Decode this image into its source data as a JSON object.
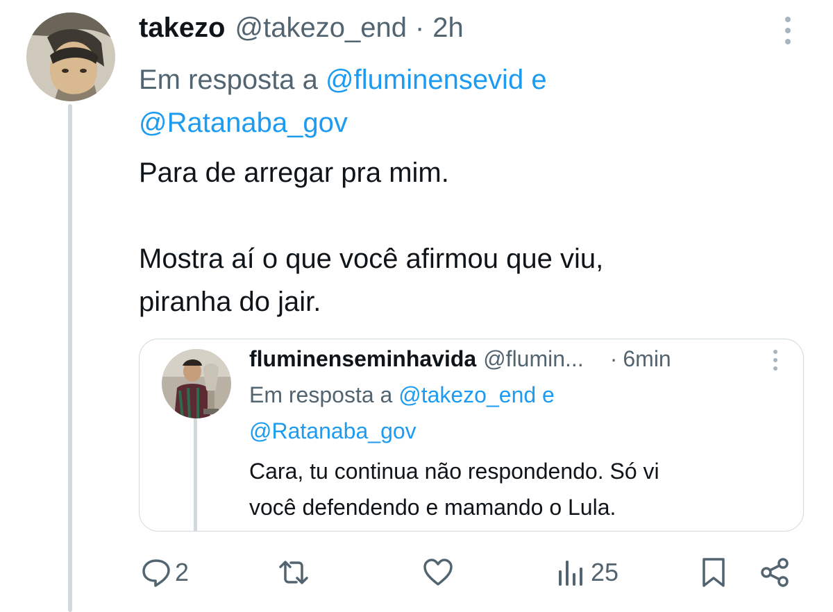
{
  "tweet": {
    "display_name": "takezo",
    "handle": "@takezo_end",
    "separator": "·",
    "time": "2h",
    "reply_prefix": "Em resposta a",
    "reply_mention_1": "@fluminensevid",
    "reply_conjunction": "e",
    "reply_mention_2": "@Ratanaba_gov",
    "text_line_1": "Para de arregar pra mim.",
    "text_line_2": "Mostra aí o que você afirmou que viu,",
    "text_line_3": "piranha do jair."
  },
  "quoted_tweet": {
    "display_name": "fluminenseminhavida",
    "handle": "@flumin...",
    "separator": "·",
    "time": "6min",
    "reply_prefix": "Em resposta a",
    "reply_mention_1": "@takezo_end",
    "reply_conjunction": "e",
    "reply_mention_2": "@Ratanaba_gov",
    "text_line_1": "Cara, tu continua não respondendo. Só vi",
    "text_line_2": "você defendendo e mamando o Lula."
  },
  "actions": {
    "reply_count": "2",
    "views_count": "25"
  },
  "icons": {
    "more": "more-vertical-icon",
    "reply": "reply-bubble-icon",
    "retweet": "retweet-icon",
    "like": "heart-icon",
    "views": "views-bar-chart-icon",
    "bookmark": "bookmark-icon",
    "share": "share-icon"
  },
  "colors": {
    "mention": "#1d9bf0",
    "secondary_text": "#536471",
    "primary_text": "#0f1419",
    "divider": "#cfd9de"
  }
}
